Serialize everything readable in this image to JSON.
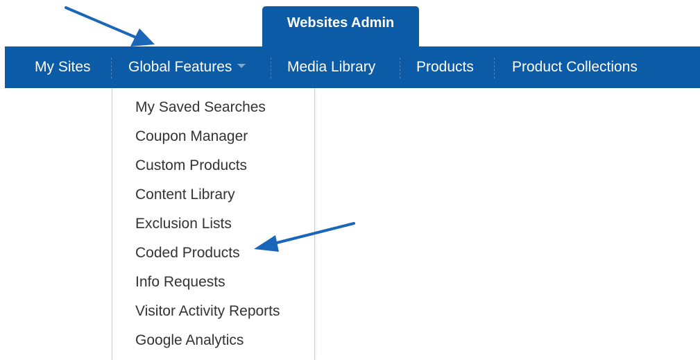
{
  "tab": {
    "label": "Websites Admin"
  },
  "nav": {
    "items": [
      {
        "label": "My Sites"
      },
      {
        "label": "Global Features"
      },
      {
        "label": "Media Library"
      },
      {
        "label": "Products"
      },
      {
        "label": "Product Collections"
      }
    ]
  },
  "dropdown": {
    "items": [
      {
        "label": "My Saved Searches"
      },
      {
        "label": "Coupon Manager"
      },
      {
        "label": "Custom Products"
      },
      {
        "label": "Content Library"
      },
      {
        "label": "Exclusion Lists"
      },
      {
        "label": "Coded Products"
      },
      {
        "label": "Info Requests"
      },
      {
        "label": "Visitor Activity Reports"
      },
      {
        "label": "Google Analytics"
      }
    ]
  },
  "colors": {
    "nav_bg": "#0b5ba6",
    "arrow": "#1a66b8",
    "menu_text": "#333333"
  }
}
